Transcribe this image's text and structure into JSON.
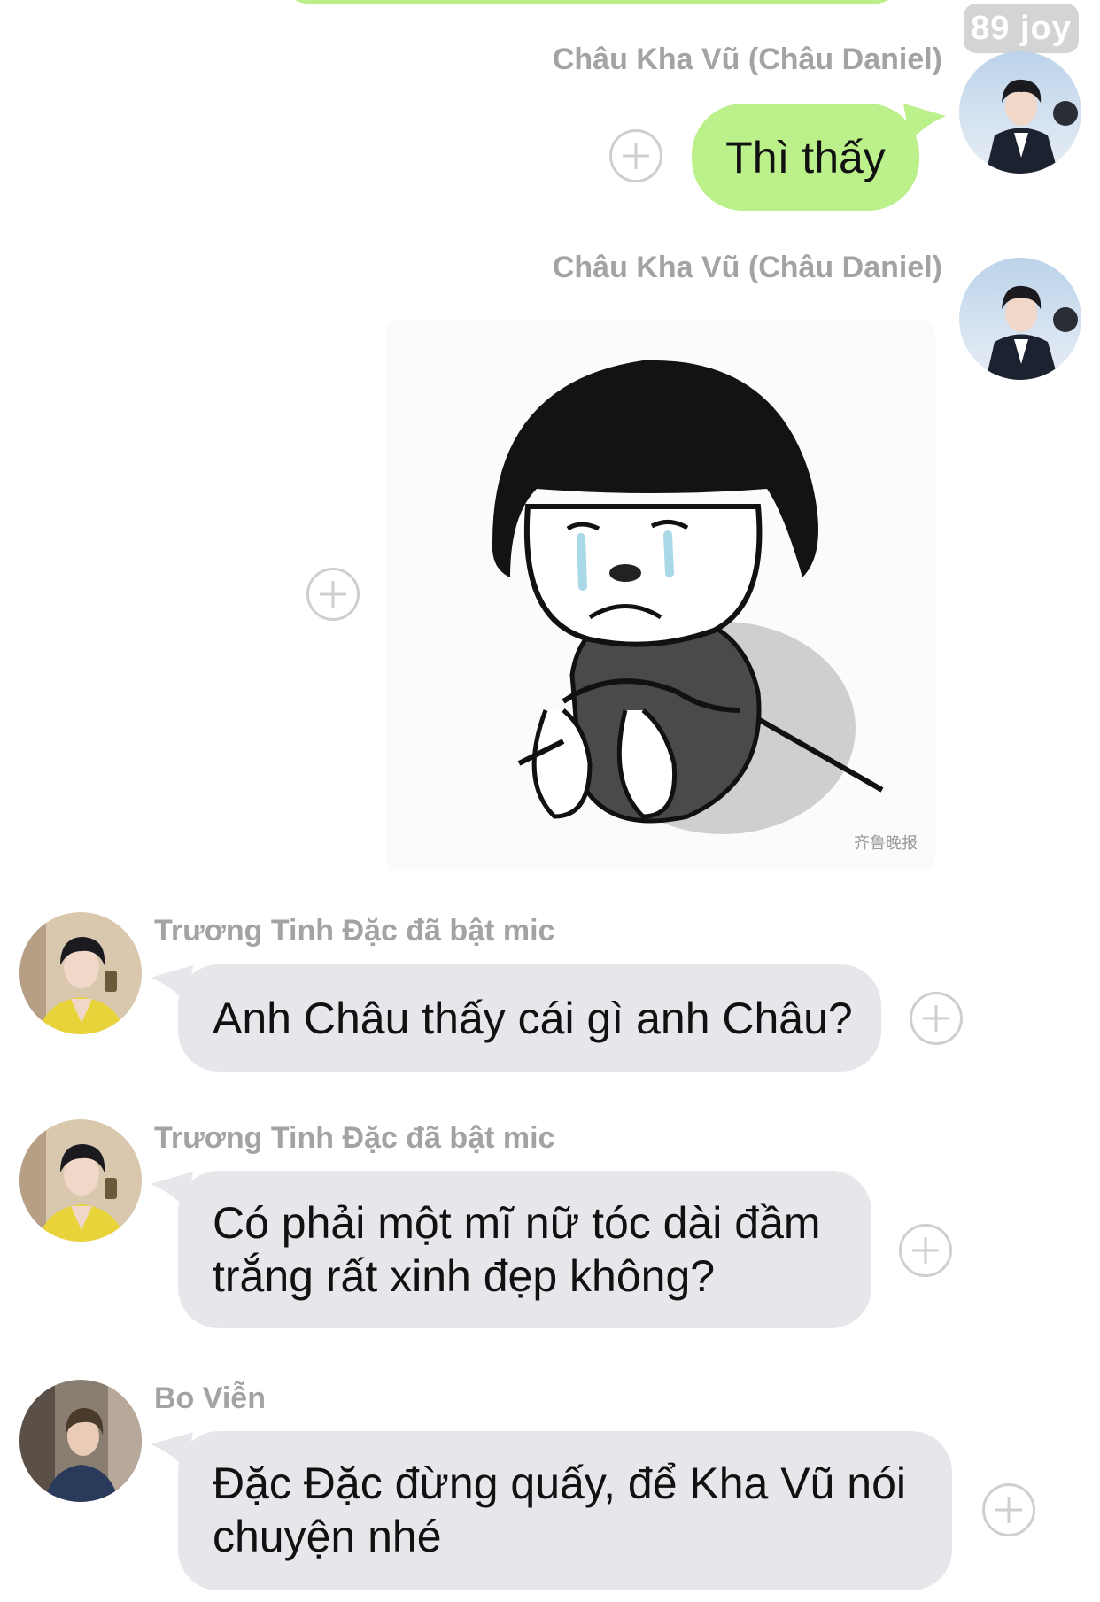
{
  "badge": {
    "text": "89 joy"
  },
  "messages": [
    {
      "sender": "Châu Kha Vũ (Châu Daniel)",
      "text": "Thì thấy",
      "side": "right"
    },
    {
      "sender": "Châu Kha Vũ (Châu Daniel)",
      "sticker": "crying-mushroom-hair-boy",
      "watermark": "齐鲁晚报",
      "side": "right"
    },
    {
      "sender": "Trương Tinh Đặc đã bật mic",
      "text": "Anh Châu thấy cái gì anh Châu?",
      "side": "left"
    },
    {
      "sender": "Trương Tinh Đặc đã bật mic",
      "lines": [
        "Có phải một mĩ nữ tóc dài đầm",
        "trắng rất xinh đẹp không?"
      ],
      "side": "left"
    },
    {
      "sender": "Bo Viễn",
      "lines": [
        "Đặc Đặc đừng quấy, để Kha Vũ nói",
        "chuyện nhé"
      ],
      "side": "left"
    }
  ],
  "colors": {
    "outgoing_bubble": "#bbf08a",
    "incoming_bubble": "#e6e7ea",
    "sender_text": "#a3a3a3",
    "badge": "#d4d4d4"
  }
}
